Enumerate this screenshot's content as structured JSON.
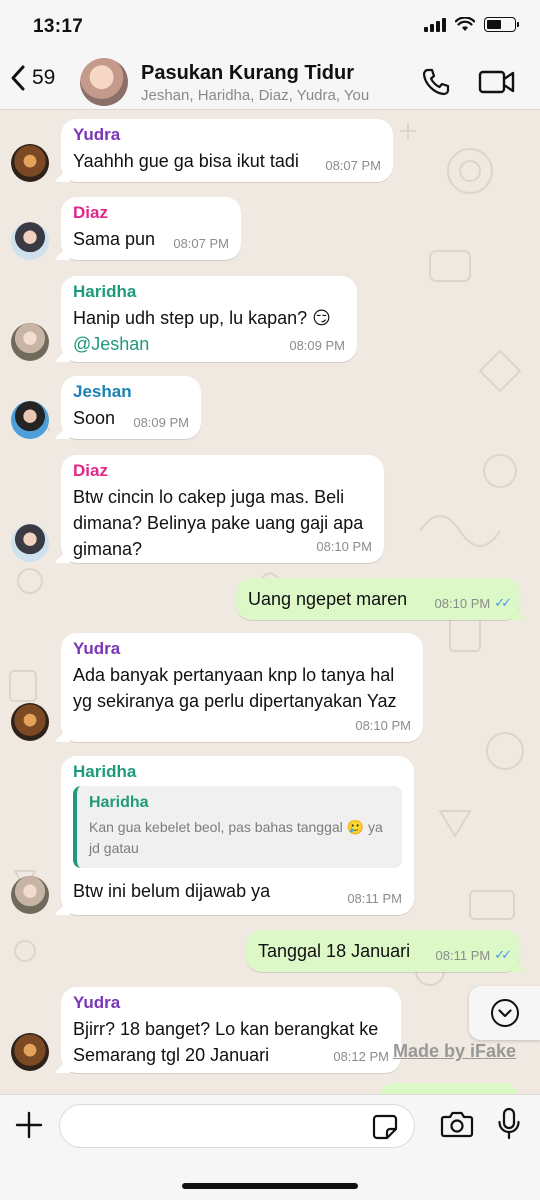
{
  "status_bar": {
    "time": "13:17",
    "battery_level": 0.55
  },
  "header": {
    "back_count": "59",
    "title": "Pasukan Kurang Tidur",
    "members": "Jeshan, Haridha, Diaz, Yudra, You"
  },
  "messages": [
    {
      "sender": "Yudra",
      "text": "Yaahhh gue ga bisa ikut tadi",
      "time": "08:07 PM"
    },
    {
      "sender": "Diaz",
      "text": "Sama pun",
      "time": "08:07 PM"
    },
    {
      "sender": "Haridha",
      "text": "Hanip udh step up, lu kapan? 😏",
      "mention": "@Jeshan",
      "time": "08:09 PM"
    },
    {
      "sender": "Jeshan",
      "text": "Soon",
      "time": "08:09 PM"
    },
    {
      "sender": "Diaz",
      "text_lines": [
        "Btw cincin lo cakep juga mas. Beli",
        "dimana? Belinya pake uang gaji apa",
        "gimana?"
      ],
      "time": "08:10 PM"
    },
    {
      "sender": "You",
      "text": "Uang ngepet maren",
      "time": "08:10 PM",
      "status": "read"
    },
    {
      "sender": "Yudra",
      "text_lines": [
        "Ada banyak pertanyaan knp lo tanya hal",
        "yg sekiranya ga perlu dipertanyakan Yaz"
      ],
      "time": "08:10 PM"
    },
    {
      "sender": "Haridha",
      "quote": {
        "sender": "Haridha",
        "text_lines": [
          "Kan gua kebelet beol, pas bahas tanggal 🥲 ya",
          "jd gatau"
        ]
      },
      "text": "Btw ini belum dijawab ya",
      "time": "08:11 PM"
    },
    {
      "sender": "You",
      "text": "Tanggal 18 Januari",
      "time": "08:11 PM",
      "status": "read"
    },
    {
      "sender": "Yudra",
      "text_lines": [
        "Bjirr? 18 banget? Lo kan berangkat ke",
        "Semarang tgl 20 Januari"
      ],
      "time": "08:12 PM"
    }
  ],
  "watermark": "Made by iFake",
  "composer": {
    "value": "",
    "placeholder": ""
  },
  "colors": {
    "chat_bg": "#efe9e1",
    "outgoing_bubble": "#dcf8c6",
    "incoming_bubble": "#ffffff",
    "yudra": "#7a35b8",
    "diaz": "#e0288b",
    "haridha": "#1f9a7a",
    "jeshan": "#1a80b5",
    "read_ticks": "#3c9ee6"
  }
}
